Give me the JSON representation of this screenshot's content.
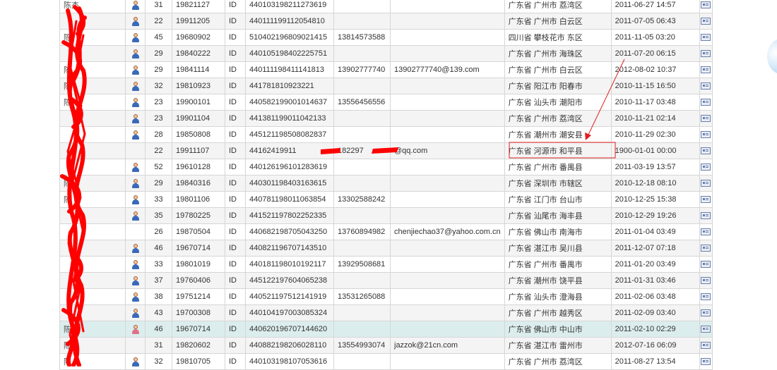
{
  "rows": [
    {
      "name": "陈杰",
      "gender": "male",
      "age": "31",
      "dob": "19821127",
      "idtype": "ID",
      "idno": "440103198211273619",
      "phone": "",
      "email": "",
      "addr": "广东省 广州市 荔湾区",
      "time": "2011-06-27 14:57"
    },
    {
      "name": "",
      "gender": "male",
      "age": "22",
      "dob": "19911205",
      "idtype": "ID",
      "idno": "440111199112054810",
      "phone": "",
      "email": "",
      "addr": "广东省 广州市 白云区",
      "time": "2011-07-05 06:43"
    },
    {
      "name": "陈",
      "gender": "male",
      "age": "45",
      "dob": "19680902",
      "idtype": "ID",
      "idno": "510402196809021415",
      "phone": "13814573588",
      "email": "",
      "addr": "四川省 攀枝花市 东区",
      "time": "2011-11-05 03:20"
    },
    {
      "name": "",
      "gender": "male",
      "age": "29",
      "dob": "19840222",
      "idtype": "ID",
      "idno": "440105198402225751",
      "phone": "",
      "email": "",
      "addr": "广东省 广州市 海珠区",
      "time": "2011-07-20 06:15"
    },
    {
      "name": "陈",
      "gender": "male",
      "age": "29",
      "dob": "19841114",
      "idtype": "ID",
      "idno": "440111198411141813",
      "phone": "13902777740",
      "email": "13902777740@139.com",
      "addr": "广东省 广州市 白云区",
      "time": "2012-08-02 10:37"
    },
    {
      "name": "陈",
      "gender": "male",
      "age": "32",
      "dob": "19810923",
      "idtype": "ID",
      "idno": "441781810923221",
      "phone": "",
      "email": "",
      "addr": "广东省 阳江市 阳春市",
      "time": "2010-11-15 16:50"
    },
    {
      "name": "陈",
      "gender": "male",
      "age": "23",
      "dob": "19900101",
      "idtype": "ID",
      "idno": "440582199001014637",
      "phone": "13556456556",
      "email": "",
      "addr": "广东省 汕头市 潮阳市",
      "time": "2010-11-17 03:48"
    },
    {
      "name": "",
      "gender": "male",
      "age": "23",
      "dob": "19901104",
      "idtype": "ID",
      "idno": "441381199011042133",
      "phone": "",
      "email": "",
      "addr": "广东省 广州市 荔湾区",
      "time": "2010-11-21 02:14"
    },
    {
      "name": "",
      "gender": "male",
      "age": "28",
      "dob": "19850808",
      "idtype": "ID",
      "idno": "445121198508082837",
      "phone": "",
      "email": "",
      "addr": "广东省 潮州市 潮安县",
      "time": "2010-11-29 02:30"
    },
    {
      "name": "",
      "gender": "none",
      "age": "22",
      "dob": "19911107",
      "idtype": "ID",
      "idno": "44162419911",
      "phone": "182297",
      "email": "@qq.com",
      "addr": "广东省 河源市 和平县",
      "time": "1900-01-01 00:00"
    },
    {
      "name": "",
      "gender": "male",
      "age": "52",
      "dob": "19610128",
      "idtype": "ID",
      "idno": "440126196101283619",
      "phone": "",
      "email": "",
      "addr": "广东省 广州市 番禺县",
      "time": "2011-03-19 13:57"
    },
    {
      "name": "陈",
      "gender": "male",
      "age": "29",
      "dob": "19840316",
      "idtype": "ID",
      "idno": "440301198403163615",
      "phone": "",
      "email": "",
      "addr": "广东省 深圳市 市辖区",
      "time": "2010-12-18 08:10"
    },
    {
      "name": "陈",
      "gender": "male",
      "age": "33",
      "dob": "19801106",
      "idtype": "ID",
      "idno": "440781198011063854",
      "phone": "13302588242",
      "email": "",
      "addr": "广东省 江门市 台山市",
      "time": "2010-12-25 15:38"
    },
    {
      "name": "",
      "gender": "male",
      "age": "35",
      "dob": "19780225",
      "idtype": "ID",
      "idno": "441521197802252335",
      "phone": "",
      "email": "",
      "addr": "广东省 汕尾市 海丰县",
      "time": "2010-12-29 19:26"
    },
    {
      "name": "",
      "gender": "none",
      "age": "26",
      "dob": "19870504",
      "idtype": "ID",
      "idno": "440682198705043250",
      "phone": "13760894982",
      "email": "chenjiechao37@yahoo.com.cn",
      "addr": "广东省 佛山市 南海市",
      "time": "2011-01-04 03:49"
    },
    {
      "name": "",
      "gender": "male",
      "age": "46",
      "dob": "19670714",
      "idtype": "ID",
      "idno": "440821196707143510",
      "phone": "",
      "email": "",
      "addr": "广东省 湛江市 吴川县",
      "time": "2011-12-07 07:18"
    },
    {
      "name": "",
      "gender": "male",
      "age": "33",
      "dob": "19801019",
      "idtype": "ID",
      "idno": "440181198010192117",
      "phone": "13929508681",
      "email": "",
      "addr": "广东省 广州市 番禺市",
      "time": "2011-01-20 03:49"
    },
    {
      "name": "",
      "gender": "male",
      "age": "37",
      "dob": "19760406",
      "idtype": "ID",
      "idno": "445122197604065238",
      "phone": "",
      "email": "",
      "addr": "广东省 潮州市 饶平县",
      "time": "2011-01-31 03:46"
    },
    {
      "name": "",
      "gender": "male",
      "age": "38",
      "dob": "19751214",
      "idtype": "ID",
      "idno": "440521197512141919",
      "phone": "13531265088",
      "email": "",
      "addr": "广东省 汕头市 澄海县",
      "time": "2011-02-06 03:48"
    },
    {
      "name": "",
      "gender": "male",
      "age": "43",
      "dob": "19700308",
      "idtype": "ID",
      "idno": "440104197003085324",
      "phone": "",
      "email": "",
      "addr": "广东省 广州市 越秀区",
      "time": "2011-02-09 03:40"
    },
    {
      "name": "陈",
      "gender": "female",
      "age": "46",
      "dob": "19670714",
      "idtype": "ID",
      "idno": "440620196707144620",
      "phone": "",
      "email": "",
      "addr": "广东省 佛山市 中山市",
      "time": "2011-02-10 02:29"
    },
    {
      "name": "陈",
      "gender": "none",
      "age": "31",
      "dob": "19820602",
      "idtype": "ID",
      "idno": "440882198206028110",
      "phone": "13554993074",
      "email": "jazzok@21cn.com",
      "addr": "广东省 湛江市 雷州市",
      "time": "2012-07-16 06:09"
    },
    {
      "name": "陈",
      "gender": "male",
      "age": "32",
      "dob": "19810705",
      "idtype": "ID",
      "idno": "440103198107053616",
      "phone": "",
      "email": "",
      "addr": "广东省 广州市 荔湾区",
      "time": "2011-08-27 13:54"
    }
  ],
  "highlight_row": 20,
  "colors": {
    "scribble": "#ff0000",
    "annotation": "#e02020",
    "row_highlight": "#dceded"
  }
}
